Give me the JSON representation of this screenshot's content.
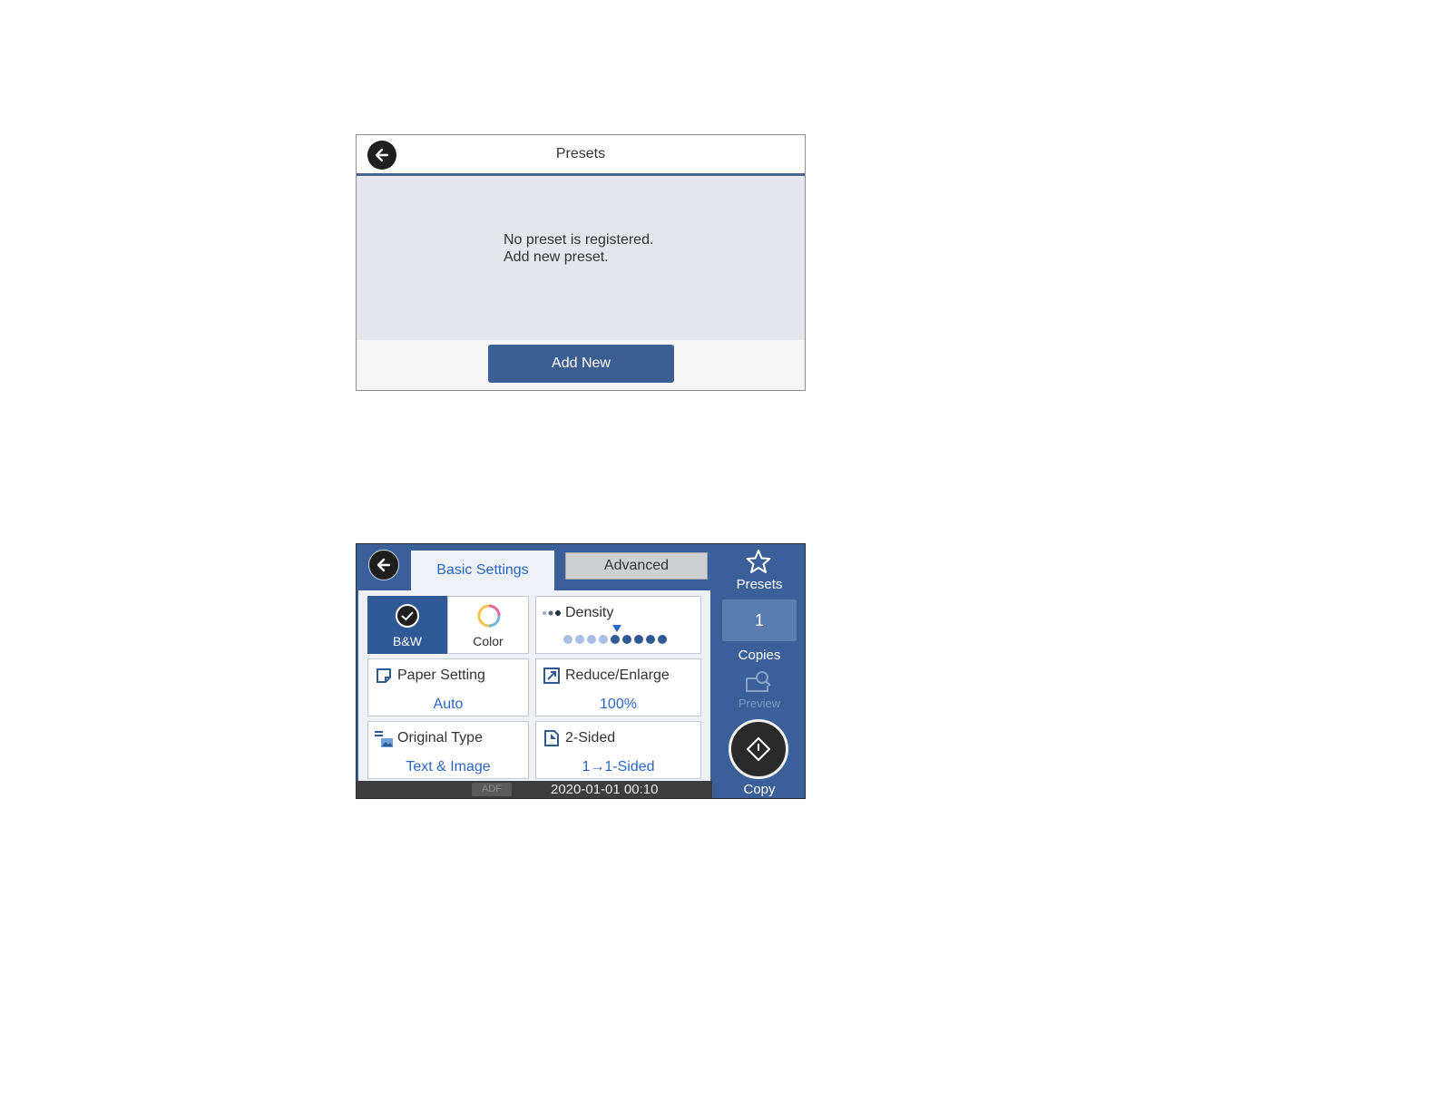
{
  "presets_screen": {
    "title": "Presets",
    "message_line1": "No preset is registered.",
    "message_line2": "Add new preset.",
    "add_button_label": "Add New"
  },
  "copy_screen": {
    "tabs": [
      {
        "label": "Basic Settings",
        "selected": true
      },
      {
        "label": "Advanced",
        "selected": false
      }
    ],
    "color_mode": {
      "bw_label": "B&W",
      "color_label": "Color",
      "selected": "B&W"
    },
    "density": {
      "label": "Density",
      "level": 5,
      "max": 9
    },
    "paper_setting": {
      "label": "Paper Setting",
      "value": "Auto"
    },
    "reduce_enlarge": {
      "label": "Reduce/Enlarge",
      "value": "100%"
    },
    "original_type": {
      "label": "Original Type",
      "value": "Text & Image"
    },
    "two_sided": {
      "label": "2-Sided",
      "value": "1→1-Sided"
    },
    "status_bar": {
      "adf": "ADF",
      "datetime": "2020-01-01 00:10"
    },
    "side_panel": {
      "presets_label": "Presets",
      "copies_value": "1",
      "copies_label": "Copies",
      "preview_label": "Preview",
      "copy_label": "Copy"
    }
  },
  "colors": {
    "accent_blue": "#3c5f93",
    "link_blue": "#2a66c9",
    "side_panel": "#3a5f99"
  }
}
